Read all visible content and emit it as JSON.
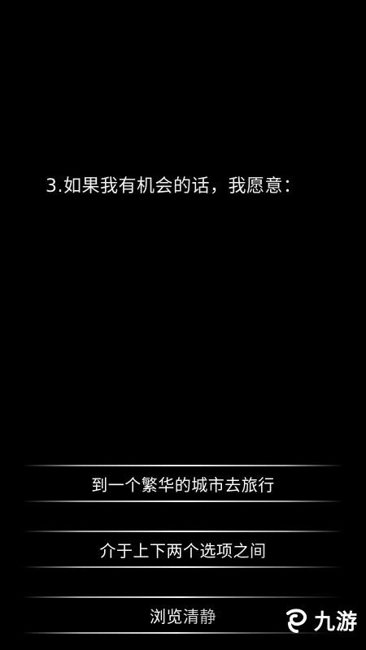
{
  "question": {
    "text": "3.如果我有机会的话，我愿意："
  },
  "options": [
    {
      "label": "到一个繁华的城市去旅行"
    },
    {
      "label": "介于上下两个选项之间"
    },
    {
      "label": "浏览清静"
    }
  ],
  "watermark": {
    "brand_icon": "swirl-logo-icon",
    "text": "九游"
  }
}
